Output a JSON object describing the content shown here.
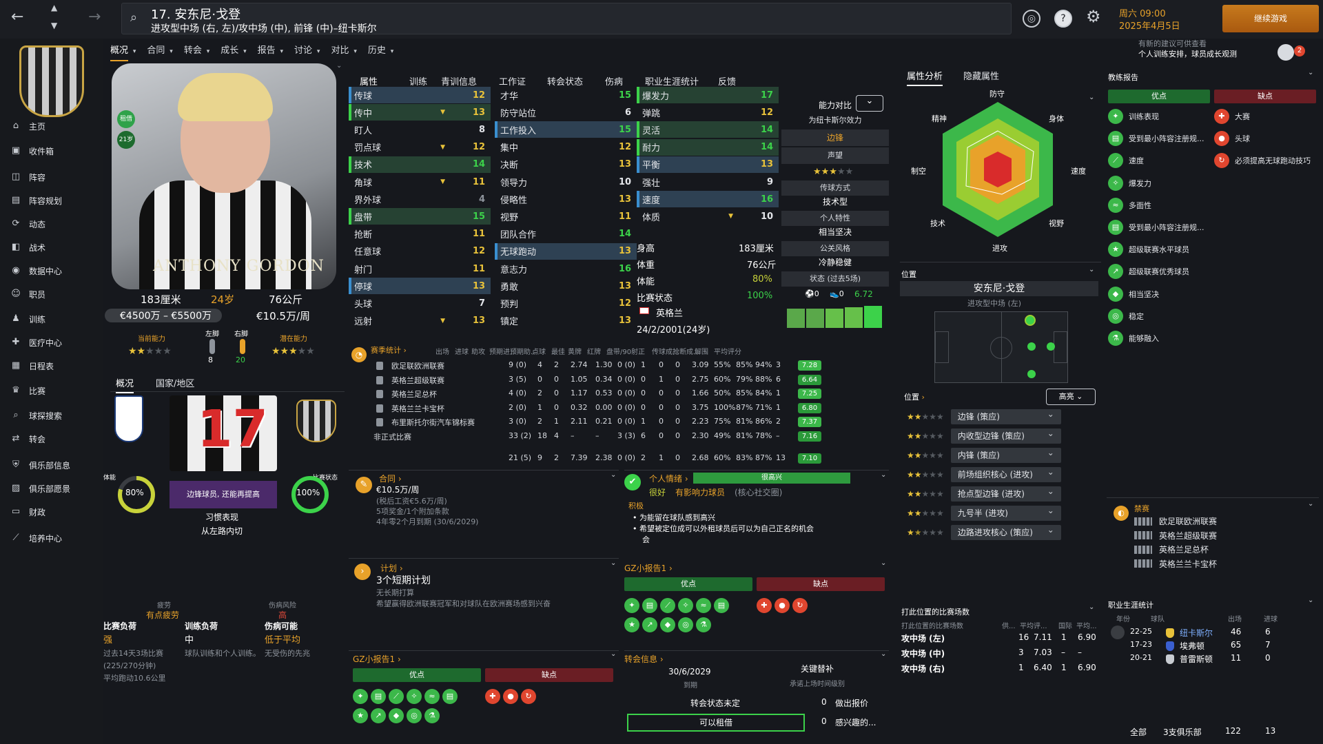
{
  "header": {
    "title": "17. 安东尼·戈登",
    "subtitle": "进攻型中场 (右, 左)/攻中场 (中), 前锋 (中)–纽卡斯尔",
    "day": "周六 09:00",
    "date": "2025年4月5日",
    "continue": "继续游戏",
    "notice1": "有新的建议可供查看",
    "notice2": "个人训练安排，球员成长观测"
  },
  "subnav": [
    "概况",
    "合同",
    "转会",
    "成长",
    "报告",
    "讨论",
    "对比",
    "历史"
  ],
  "sidebar": [
    "主页",
    "收件箱",
    "阵容",
    "阵容规划",
    "动态",
    "战术",
    "数据中心",
    "职员",
    "训练",
    "医疗中心",
    "日程表",
    "比赛",
    "球探搜索",
    "转会",
    "俱乐部信息",
    "俱乐部愿景",
    "财政",
    "培养中心"
  ],
  "profile": {
    "photo_name": "ANTHONY GORDON",
    "height": "183厘米",
    "age": "24岁",
    "weight": "76公斤",
    "value": "€4500万 – €5500万",
    "wage": "€10.5万/周",
    "ca_label": "当前能力",
    "pa_label": "潜在能力",
    "left_label": "左脚",
    "right_label": "右脚",
    "left_val": "8",
    "right_val": "20",
    "badge1": "租借",
    "badge2": "21岁"
  },
  "card": {
    "tabs": [
      "概况",
      "国家/地区"
    ],
    "number": "17",
    "role": "边锋球员, 还能再提高",
    "fitness_label": "体能",
    "fitness": "80%",
    "form_label": "比赛状态",
    "form": "100%",
    "habit": "习惯表现",
    "habit_val": "从左路内切"
  },
  "fatigue": {
    "tired_l": "疲劳",
    "tired": "有点疲劳",
    "risk_l": "伤病风险",
    "risk": "高",
    "load_l": "比赛负荷",
    "load": "强",
    "train_l": "训练负荷",
    "train": "中",
    "inj_l": "伤病可能",
    "inj": "低于平均",
    "note1": "过去14天3场比赛",
    "note2": "(225/270分钟)",
    "note3": "平均跑动10.6公里",
    "note4": "球队训练和个人训练。",
    "note5": "无受伤的先兆"
  },
  "tabs": [
    "属性",
    "训练",
    "青训信息",
    "工作证",
    "转会状态",
    "伤病",
    "职业生涯统计",
    "反馈"
  ],
  "tech": [
    [
      "传球",
      "12"
    ],
    [
      "传中",
      "13"
    ],
    [
      "盯人",
      "8"
    ],
    [
      "罚点球",
      "12"
    ],
    [
      "技术",
      "14"
    ],
    [
      "角球",
      "11"
    ],
    [
      "界外球",
      "4"
    ],
    [
      "盘带",
      "15"
    ],
    [
      "抢断",
      "11"
    ],
    [
      "任意球",
      "12"
    ],
    [
      "射门",
      "11"
    ],
    [
      "停球",
      "13"
    ],
    [
      "头球",
      "7"
    ],
    [
      "远射",
      "13"
    ]
  ],
  "mental": [
    [
      "才华",
      "15"
    ],
    [
      "防守站位",
      "6"
    ],
    [
      "工作投入",
      "15"
    ],
    [
      "集中",
      "12"
    ],
    [
      "决断",
      "13"
    ],
    [
      "领导力",
      "10"
    ],
    [
      "侵略性",
      "13"
    ],
    [
      "视野",
      "11"
    ],
    [
      "团队合作",
      "14"
    ],
    [
      "无球跑动",
      "13"
    ],
    [
      "意志力",
      "16"
    ],
    [
      "勇敢",
      "13"
    ],
    [
      "预判",
      "12"
    ],
    [
      "镇定",
      "13"
    ]
  ],
  "phys": [
    [
      "爆发力",
      "17"
    ],
    [
      "弹跳",
      "12"
    ],
    [
      "灵活",
      "14"
    ],
    [
      "耐力",
      "14"
    ],
    [
      "平衡",
      "13"
    ],
    [
      "强壮",
      "9"
    ],
    [
      "速度",
      "16"
    ],
    [
      "体质",
      "10"
    ]
  ],
  "bio": {
    "h_l": "身高",
    "h": "183厘米",
    "w_l": "体重",
    "w": "76公斤",
    "fit_l": "体能",
    "fit": "80%",
    "form_l": "比赛状态",
    "form": "100%",
    "nation": "英格兰",
    "dob": "24/2/2001(24岁)"
  },
  "comp": {
    "label": "能力对比",
    "club": "为纽卡斯尔效力",
    "pos": "边锋",
    "rep_l": "声望",
    "pass_l": "传球方式",
    "pass": "技术型",
    "trait_l": "个人特性",
    "trait": "相当坚决",
    "media_l": "公关风格",
    "media": "冷静稳健",
    "form5_l": "状态 (过去5场)",
    "g": "0",
    "a": "0",
    "avg": "6.72"
  },
  "season": {
    "title": "赛季统计",
    "cols": [
      "出场",
      "进球",
      "助攻",
      "预期进...",
      "预期助...",
      "点球",
      "最佳",
      "黄牌",
      "红牌",
      "盘带/90",
      "射正",
      "传球成...",
      "抢断成...",
      "解围",
      "平均评分"
    ],
    "rows": [
      [
        "欧足联欧洲联赛",
        "9 (0)",
        "4",
        "2",
        "2.74",
        "1.30",
        "0 (0)",
        "1",
        "0",
        "0",
        "3.09",
        "55%",
        "85%",
        "94%",
        "3",
        "7.28"
      ],
      [
        "英格兰超级联赛",
        "3 (5)",
        "0",
        "0",
        "1.05",
        "0.34",
        "0 (0)",
        "0",
        "1",
        "0",
        "2.75",
        "60%",
        "79%",
        "88%",
        "6",
        "6.64"
      ],
      [
        "英格兰足总杯",
        "4 (0)",
        "2",
        "0",
        "1.17",
        "0.53",
        "0 (0)",
        "0",
        "0",
        "0",
        "1.66",
        "50%",
        "85%",
        "84%",
        "1",
        "7.25"
      ],
      [
        "英格兰兰卡宝杯",
        "2 (0)",
        "1",
        "0",
        "0.32",
        "0.00",
        "0 (0)",
        "0",
        "0",
        "0",
        "3.75",
        "100%",
        "87%",
        "71%",
        "1",
        "6.80"
      ],
      [
        "布里斯托尔街汽车锦标赛",
        "3 (0)",
        "2",
        "1",
        "2.11",
        "0.21",
        "0 (0)",
        "1",
        "0",
        "0",
        "2.23",
        "75%",
        "81%",
        "86%",
        "2",
        "7.37"
      ],
      [
        "非正式比赛",
        "33 (2)",
        "18",
        "4",
        "–",
        "–",
        "3 (3)",
        "6",
        "0",
        "0",
        "2.30",
        "49%",
        "81%",
        "78%",
        "–",
        "7.16"
      ],
      [
        "",
        "21 (5)",
        "9",
        "2",
        "7.39",
        "2.38",
        "0 (0)",
        "2",
        "1",
        "0",
        "2.68",
        "60%",
        "83%",
        "87%",
        "13",
        "7.10"
      ]
    ]
  },
  "contract": {
    "title": "合同",
    "wage": "€10.5万/周",
    "l1": "(税后工资€5.6万/周)",
    "l2": "5项奖金/1个附加条款",
    "l3": "4年零2个月到期 (30/6/2029)"
  },
  "mood": {
    "title": "个人情绪",
    "bar": "很高兴",
    "status": "很好",
    "tag": "有影响力球员",
    "tag2": "(核心社交圈)",
    "pos": "积极",
    "b1": "为能留在球队感到高兴",
    "b2": "希望被定位成可以外租球员后可以为自己正名的机会",
    "b3": "会"
  },
  "plan": {
    "title": "计划",
    "main": "3个短期计划",
    "sub": "无长期打算",
    "note": "希望赢得欧洲联赛冠军和对球队在欧洲赛场感到兴奋"
  },
  "gz": {
    "title": "GZ小报告1",
    "pros": "优点",
    "cons": "缺点"
  },
  "transfer": {
    "title": "转会信息",
    "date": "30/6/2029",
    "due": "到期",
    "key": "关键替补",
    "keynote": "承诺上场时间级别",
    "status": "转会状态未定",
    "loan": "可以租借",
    "offers": "0",
    "offers_l": "做出报价",
    "interest": "0",
    "interest_l": "感兴趣的..."
  },
  "analysis": {
    "tabs": [
      "属性分析",
      "隐藏属性"
    ],
    "labels": [
      "防守",
      "身体",
      "速度",
      "视野",
      "进攻",
      "技术",
      "制空",
      "精神"
    ]
  },
  "position": {
    "title": "位置",
    "name": "安东尼·戈登",
    "role": "进攻型中场 (左)",
    "pos_l": "位置",
    "high": "高亮",
    "rows": [
      [
        "边锋 (策应)",
        2
      ],
      [
        "内收型边锋 (策应)",
        2
      ],
      [
        "内锋 (策应)",
        2
      ],
      [
        "前场组织核心 (进攻)",
        2
      ],
      [
        "抢点型边锋 (进攻)",
        2
      ],
      [
        "九号半 (进攻)",
        2
      ],
      [
        "边路进攻核心 (策应)",
        1.5
      ]
    ]
  },
  "played": {
    "title": "打此位置的比赛场数",
    "sub": "打此位置的比赛场数",
    "cols": [
      "供...",
      "平均评...",
      "国际",
      "平均..."
    ],
    "rows": [
      [
        "攻中场 (左)",
        "16",
        "7.11",
        "1",
        "6.90"
      ],
      [
        "攻中场 (中)",
        "3",
        "7.03",
        "–",
        "–"
      ],
      [
        "攻中场 (右)",
        "1",
        "6.40",
        "1",
        "6.90"
      ]
    ]
  },
  "coach": {
    "title": "教练报告",
    "pros": "优点",
    "cons": "缺点",
    "plist": [
      "训练表现",
      "受到最小阵容注册规...",
      "速度",
      "爆发力",
      "多面性",
      "受到最小阵容注册规...",
      "超级联赛水平球员",
      "超级联赛优秀球员",
      "相当坚决",
      "稳定",
      "能够融入"
    ],
    "clist": [
      "大赛",
      "头球",
      "必须提高无球跑动技巧"
    ]
  },
  "ban": {
    "title": "禁赛",
    "items": [
      "欧足联欧洲联赛",
      "英格兰超级联赛",
      "英格兰足总杯",
      "英格兰兰卡宝杯"
    ]
  },
  "career": {
    "title": "职业生涯统计",
    "cols": [
      "年份",
      "球队",
      "出场",
      "进球"
    ],
    "rows": [
      [
        "22-25",
        "纽卡斯尔",
        "46",
        "6"
      ],
      [
        "17-23",
        "埃弗顿",
        "65",
        "7"
      ],
      [
        "20-21",
        "普雷斯顿",
        "11",
        "0"
      ]
    ],
    "total": "全部",
    "clubs": "3支俱乐部",
    "apps": "122",
    "goals": "13"
  }
}
